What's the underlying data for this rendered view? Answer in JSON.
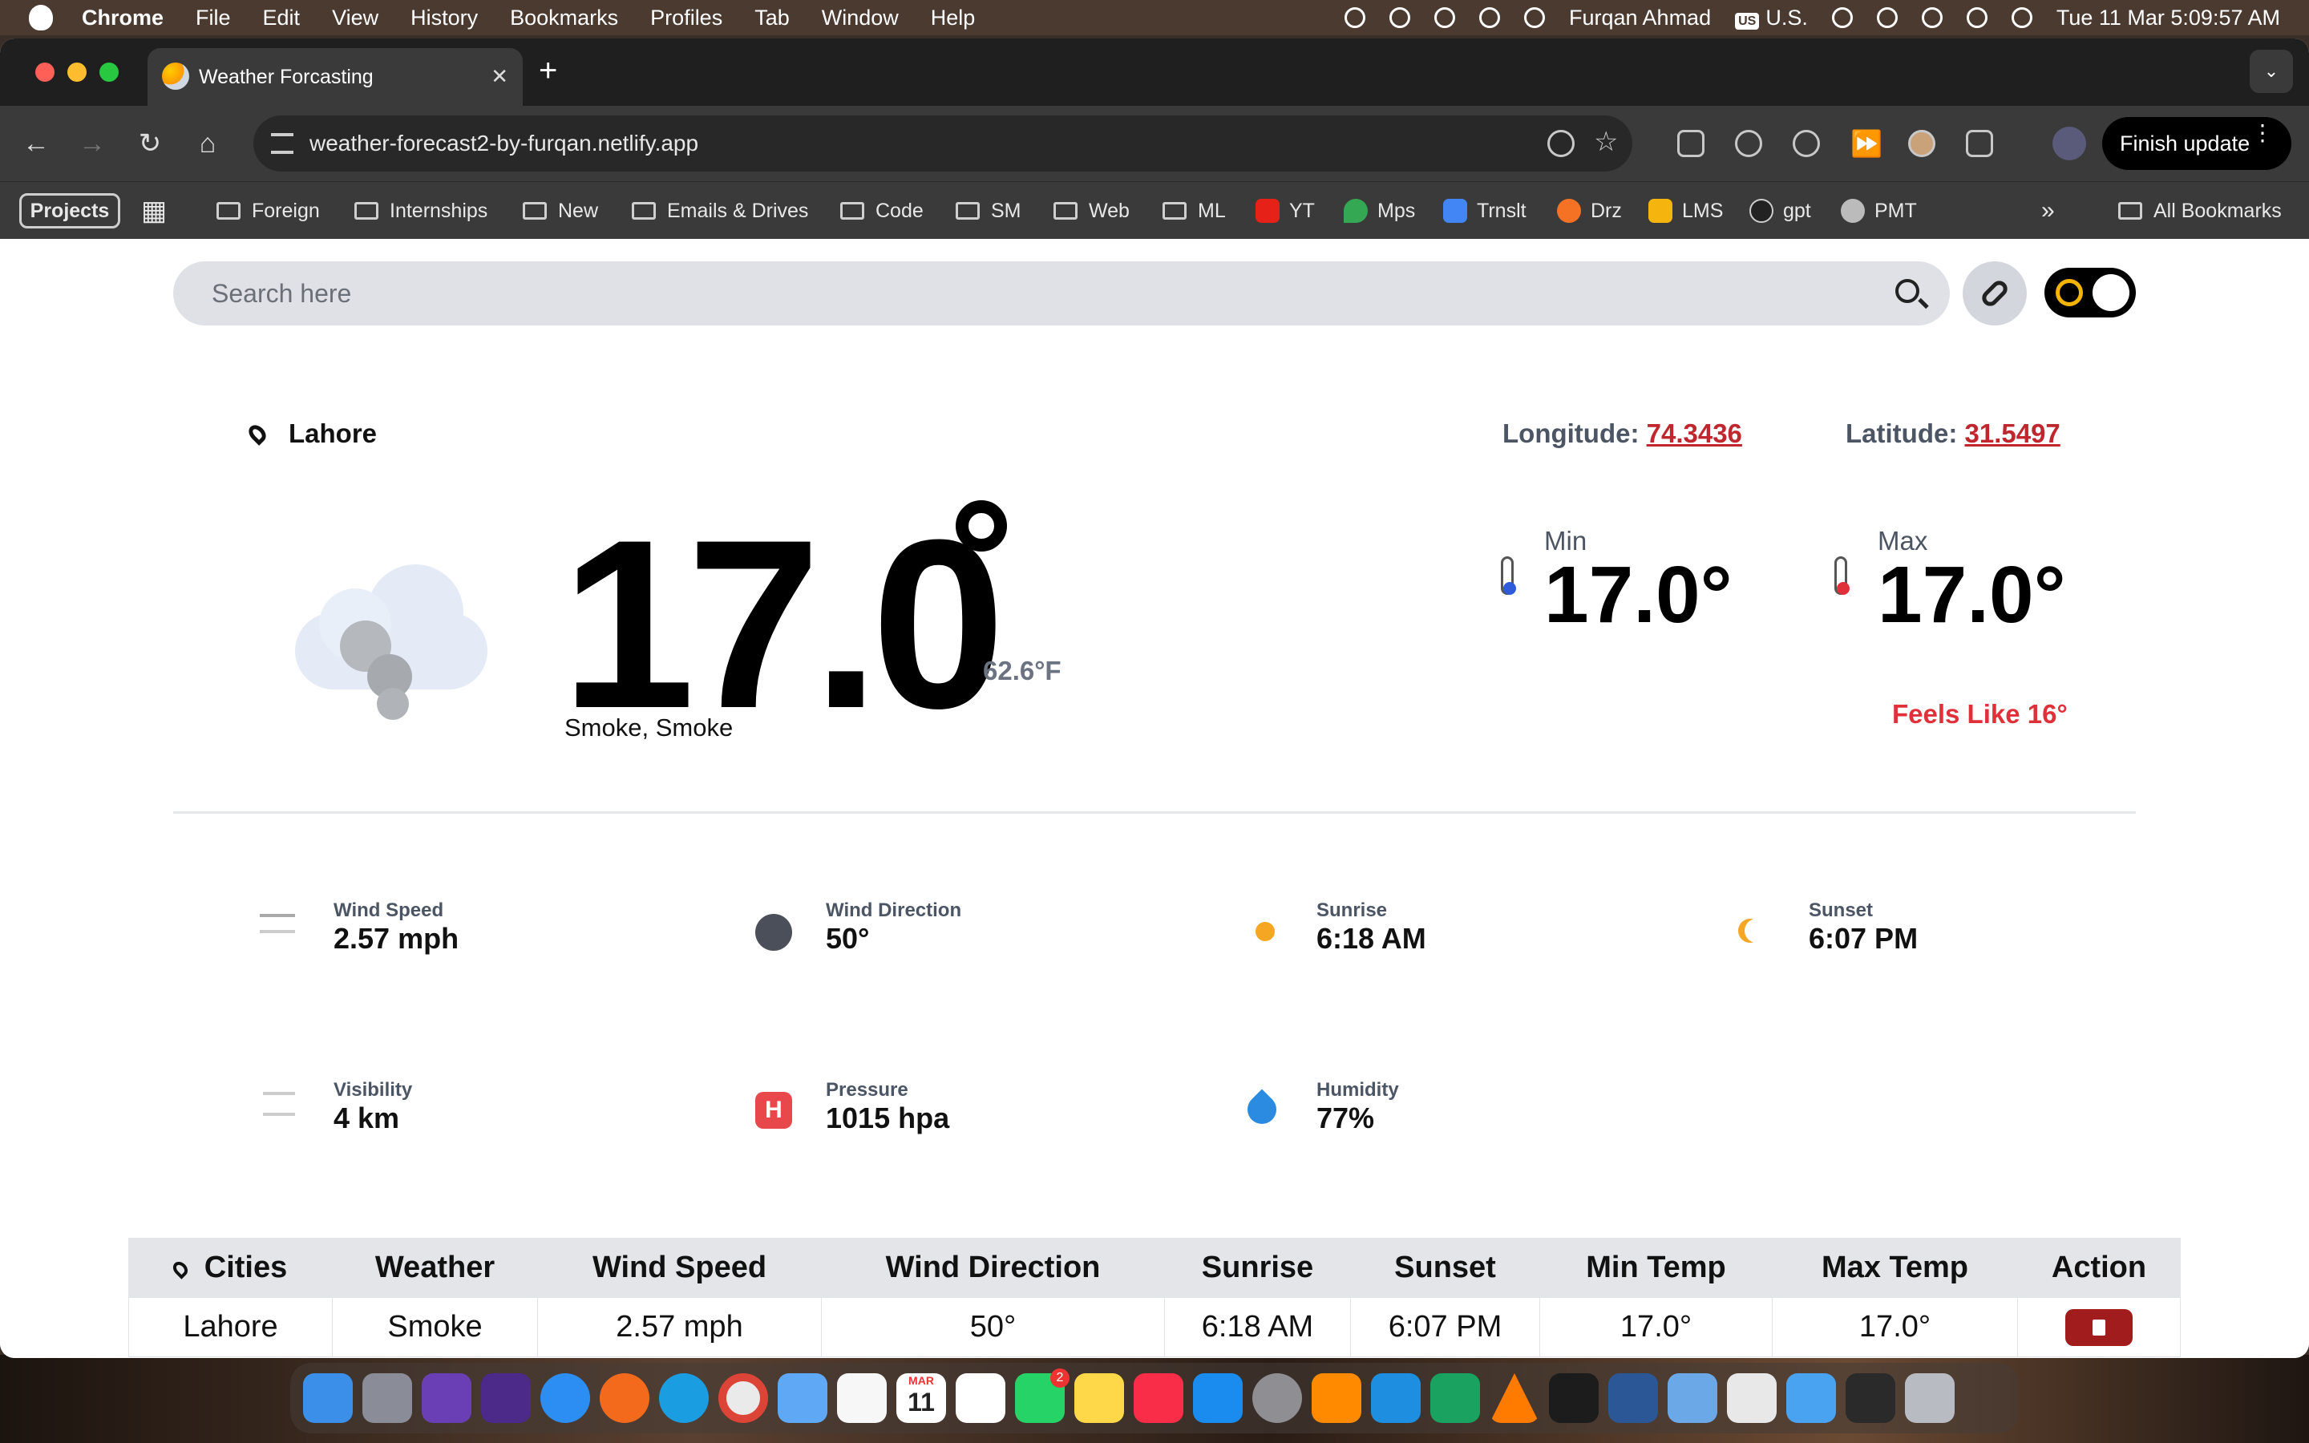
{
  "menubar": {
    "app": "Chrome",
    "items": [
      "File",
      "Edit",
      "View",
      "History",
      "Bookmarks",
      "Profiles",
      "Tab",
      "Window",
      "Help"
    ],
    "user": "Furqan Ahmad",
    "keyboard_badge": "US",
    "keyboard": "U.S.",
    "datetime": "Tue 11 Mar  5:09:57 AM"
  },
  "browser": {
    "tab_title": "Weather Forcasting",
    "new_tab": "+",
    "url": "weather-forecast2-by-furqan.netlify.app",
    "finish_update": "Finish update",
    "bookmarks": {
      "projects": "Projects",
      "items": [
        "Foreign",
        "Internships",
        "New",
        "Emails & Drives",
        "Code",
        "SM",
        "Web",
        "ML",
        "YT",
        "Mps",
        "Trnslt",
        "Drz",
        "LMS",
        "gpt",
        "PMT"
      ],
      "more": "»",
      "all": "All Bookmarks"
    }
  },
  "app": {
    "search_placeholder": "Search here",
    "city": "Lahore",
    "longitude_label": "Longitude:",
    "longitude": "74.3436",
    "latitude_label": "Latitude:",
    "latitude": "31.5497",
    "temp": "17.0",
    "temp_f": "62.6°F",
    "description": "Smoke, Smoke",
    "min_label": "Min",
    "min": "17.0°",
    "max_label": "Max",
    "max": "17.0°",
    "feels_like": "Feels Like 16°",
    "stats": {
      "wind_speed": {
        "label": "Wind Speed",
        "value": "2.57 mph"
      },
      "wind_direction": {
        "label": "Wind Direction",
        "value": "50°"
      },
      "sunrise": {
        "label": "Sunrise",
        "value": "6:18 AM"
      },
      "sunset": {
        "label": "Sunset",
        "value": "6:07 PM"
      },
      "visibility": {
        "label": "Visibility",
        "value": "4 km"
      },
      "pressure": {
        "label": "Pressure",
        "value": "1015 hpa"
      },
      "humidity": {
        "label": "Humidity",
        "value": "77%"
      }
    },
    "table": {
      "headers": [
        "Cities",
        "Weather",
        "Wind Speed",
        "Wind Direction",
        "Sunrise",
        "Sunset",
        "Min Temp",
        "Max Temp",
        "Action"
      ],
      "row": [
        "Lahore",
        "Smoke",
        "2.57 mph",
        "50°",
        "6:18 AM",
        "6:07 PM",
        "17.0°",
        "17.0°"
      ]
    }
  },
  "colors": {
    "accent_red": "#c0262d",
    "feels_red": "#e0303a",
    "delete_red": "#a11d1d"
  },
  "dock": {
    "calendar_month": "MAR",
    "calendar_day": "11",
    "whatsapp_badge": "2"
  }
}
